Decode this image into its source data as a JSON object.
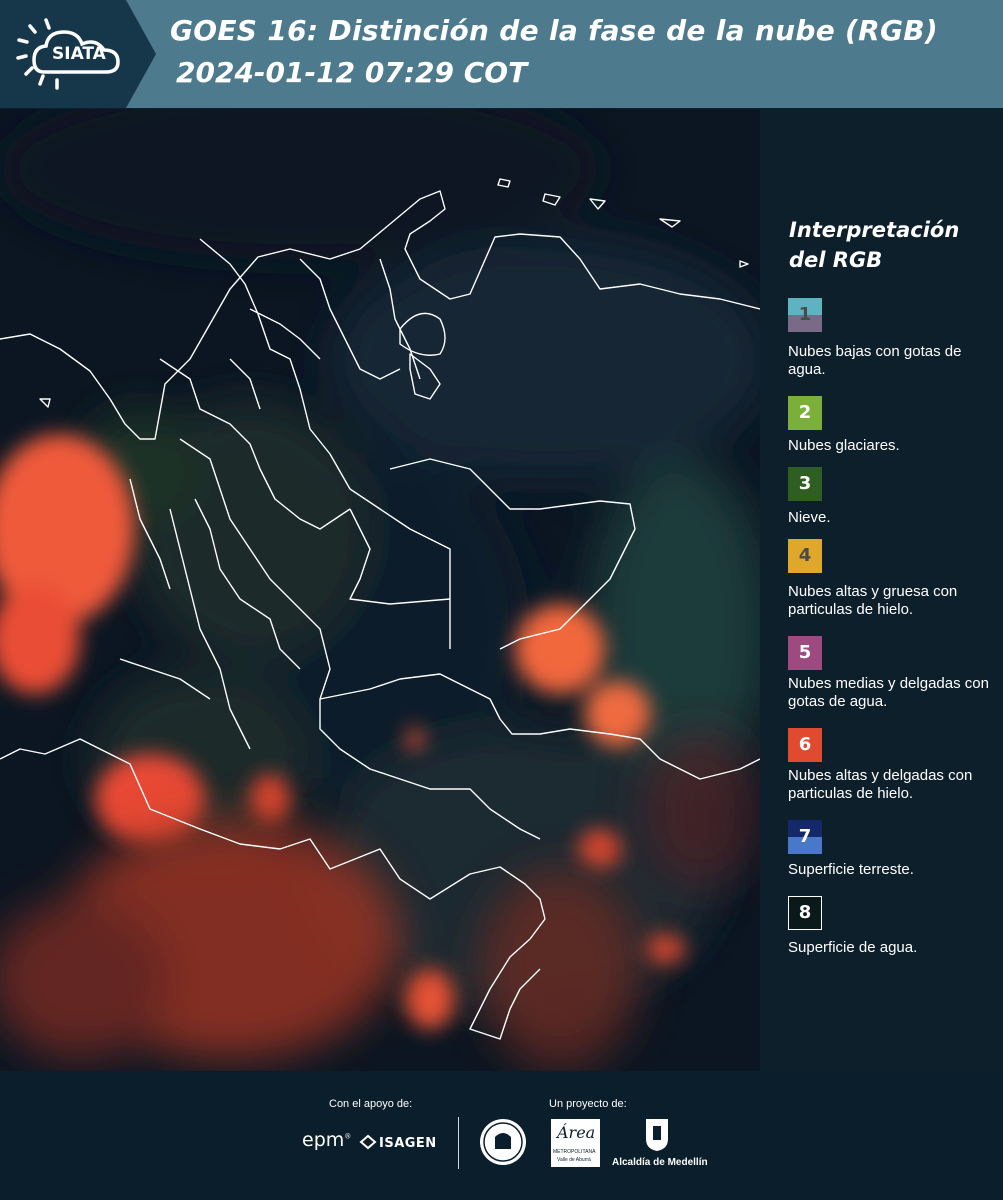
{
  "header": {
    "logo_text": "SIATA",
    "title": "GOES 16: Distinción de la fase de la nube (RGB)",
    "subtitle": "2024-01-12 07:29 COT"
  },
  "legend": {
    "title_line1": "Interpretación",
    "title_line2": "del RGB",
    "items": [
      {
        "number": "1",
        "label": "Nubes bajas con gotas de agua.",
        "color_top": "#5eb3c0",
        "color_bottom": "#7b6a87",
        "text_color": "#4a4a4a"
      },
      {
        "number": "2",
        "label": "Nubes glaciares.",
        "color_top": "#7ab03a",
        "color_bottom": "#7ab03a",
        "text_color": "#ffffff"
      },
      {
        "number": "3",
        "label": "Nieve.",
        "color_top": "#2e5e20",
        "color_bottom": "#2e5e20",
        "text_color": "#ffffff"
      },
      {
        "number": "4",
        "label": "Nubes altas y gruesa con particulas de hielo.",
        "color_top": "#e0a82a",
        "color_bottom": "#e0a82a",
        "text_color": "#4a4a4a"
      },
      {
        "number": "5",
        "label": "Nubes medias y delgadas con gotas de agua.",
        "color_top": "#9c4a80",
        "color_bottom": "#9c4a80",
        "text_color": "#ffffff"
      },
      {
        "number": "6",
        "label": "Nubes altas y delgadas con particulas de hielo.",
        "color_top": "#e04a2e",
        "color_bottom": "#e04a2e",
        "text_color": "#ffffff"
      },
      {
        "number": "7",
        "label": "Superficie terreste.",
        "color_top": "#14286a",
        "color_bottom": "#4a78c8",
        "text_color": "#ffffff"
      },
      {
        "number": "8",
        "label": "Superficie de agua.",
        "color_top": "#0a1a1a",
        "color_bottom": "#0a1a1a",
        "text_color": "#ffffff"
      }
    ]
  },
  "footer": {
    "support_label": "Con el apoyo de:",
    "project_label": "Un proyecto de:",
    "sponsor_epm": "epm",
    "sponsor_isagen": "ISAGEN",
    "metro_logo": "Área",
    "metro_text1": "METROPOLITANA",
    "metro_text2": "Valle de Aburrá",
    "alcaldia_text": "Alcaldía de Medellín"
  },
  "colors": {
    "header_band": "#4e7a8d",
    "legend_bg": "#0e1f2c",
    "footer_bg": "#0b1e2b"
  }
}
